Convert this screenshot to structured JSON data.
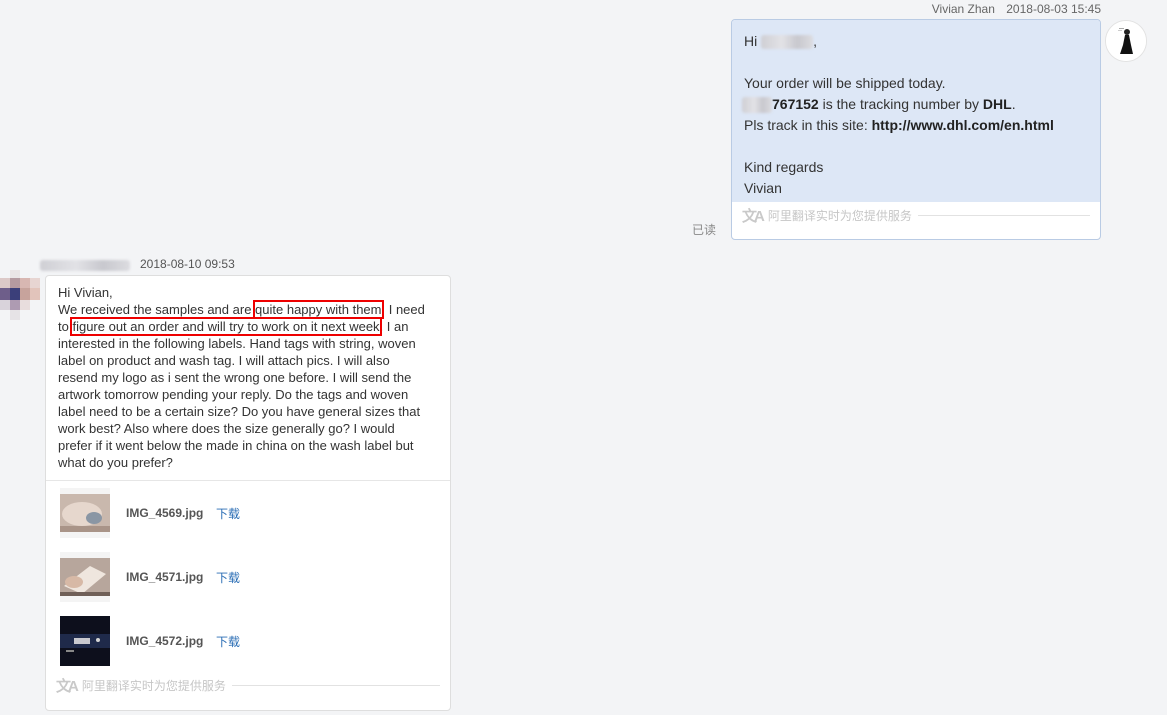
{
  "outgoing": {
    "sender_name": "Vivian Zhan",
    "timestamp": "2018-08-03 15:45",
    "greeting": "Hi",
    "greeting_suffix": ",",
    "line_shipped": "Your order will be shipped today.",
    "tracking_number": "767152",
    "tracking_text": " is the tracking number by ",
    "carrier": "DHL",
    "period": ".",
    "track_prefix": "Pls track in this site: ",
    "track_url": "http://www.dhl.com/en.html",
    "regards": "Kind regards",
    "signature": "Vivian",
    "read_status": "已读"
  },
  "translate_notice": "阿里翻译实时为您提供服务",
  "incoming": {
    "timestamp": "2018-08-10 09:53",
    "lines": {
      "l1": "Hi Vivian,",
      "l2a": "We received the samples and are ",
      "l2b": "quite happy with them",
      "l2c": ". I need",
      "l3a": "to ",
      "l3b": "figure out an order and will try to work on it next week",
      "l3c": ". I an",
      "l4": "interested in the following labels. Hand tags with string, woven",
      "l5": "label on product and wash tag. I will attach pics. I will also",
      "l6": "resend my logo as i sent the wrong one before. I will send the",
      "l7": "artwork tomorrow pending your reply. Do the tags and woven",
      "l8": "label need to be a certain size? Do you have general sizes that",
      "l9": "work best? Also where does the size generally go? I would",
      "l10": "prefer if it went below the made in china on the wash label but",
      "l11": "what do you prefer?"
    },
    "attachments": [
      {
        "filename": "IMG_4569.jpg",
        "download_label": "下载"
      },
      {
        "filename": "IMG_4571.jpg",
        "download_label": "下载"
      },
      {
        "filename": "IMG_4572.jpg",
        "download_label": "下载"
      }
    ]
  },
  "colors": {
    "outgoing_bubble": "#dde7f6",
    "highlight_box": "#e00000",
    "link_blue": "#2b6eb5"
  }
}
